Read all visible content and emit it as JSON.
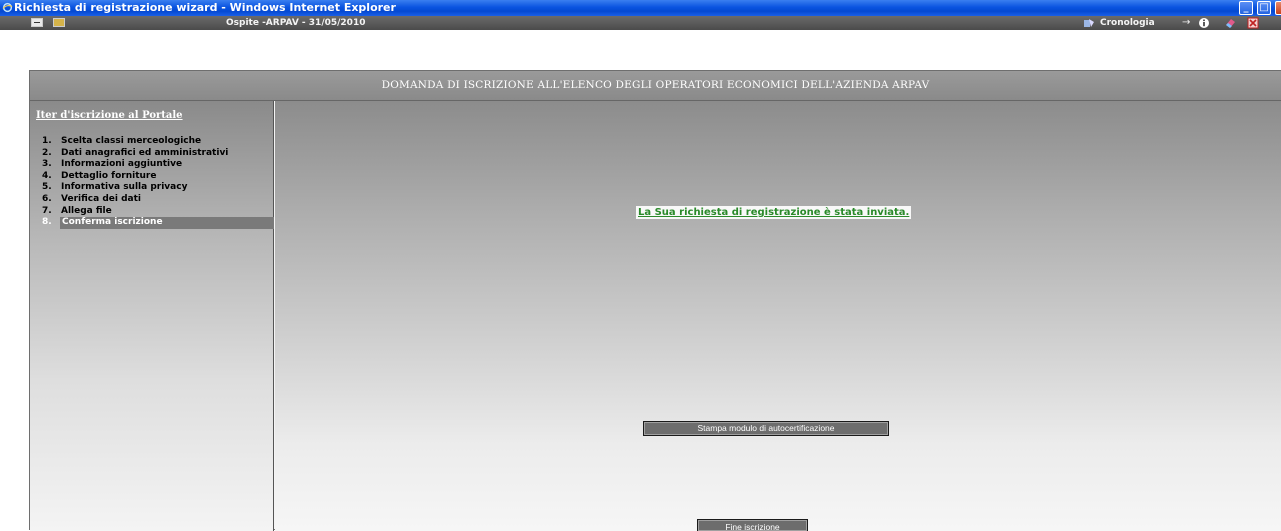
{
  "window": {
    "title": "Richiesta di registrazione wizard - Windows Internet Explorer",
    "controls": {
      "minimize": "_",
      "maximize": "□",
      "close": "×"
    }
  },
  "toolbar": {
    "user_info": "Ospite -ARPAV - 31/05/2010",
    "history_label": "Cronologia",
    "arrow": "→",
    "icons": [
      "minimize-icon",
      "folder-icon",
      "history-icon",
      "info-icon",
      "eraser-icon",
      "exit-icon"
    ]
  },
  "header": {
    "title": "DOMANDA DI ISCRIZIONE ALL'ELENCO DEGLI OPERATORI ECONOMICI DELL'AZIENDA ARPAV"
  },
  "sidebar": {
    "title": "Iter d'iscrizione al Portale",
    "steps": [
      {
        "num": "1.",
        "label": "Scelta classi merceologiche",
        "active": false
      },
      {
        "num": "2.",
        "label": "Dati anagrafici ed amministrativi",
        "active": false
      },
      {
        "num": "3.",
        "label": "Informazioni aggiuntive",
        "active": false
      },
      {
        "num": "4.",
        "label": "Dettaglio forniture",
        "active": false
      },
      {
        "num": "5.",
        "label": "Informativa sulla privacy",
        "active": false
      },
      {
        "num": "6.",
        "label": "Verifica dei dati",
        "active": false
      },
      {
        "num": "7.",
        "label": "Allega file",
        "active": false
      },
      {
        "num": "8.",
        "label": "Conferma iscrizione",
        "active": true
      }
    ]
  },
  "main": {
    "message": "La Sua richiesta di registrazione è stata inviata.",
    "print_button": "Stampa modulo di autocertificazione",
    "end_button": "Fine iscrizione"
  },
  "colors": {
    "title_bar": "#0a54e0",
    "toolbar": "#555555",
    "header": "#8f8f8f",
    "success_text": "#2a8a2a",
    "button": "#6d6d6d"
  }
}
